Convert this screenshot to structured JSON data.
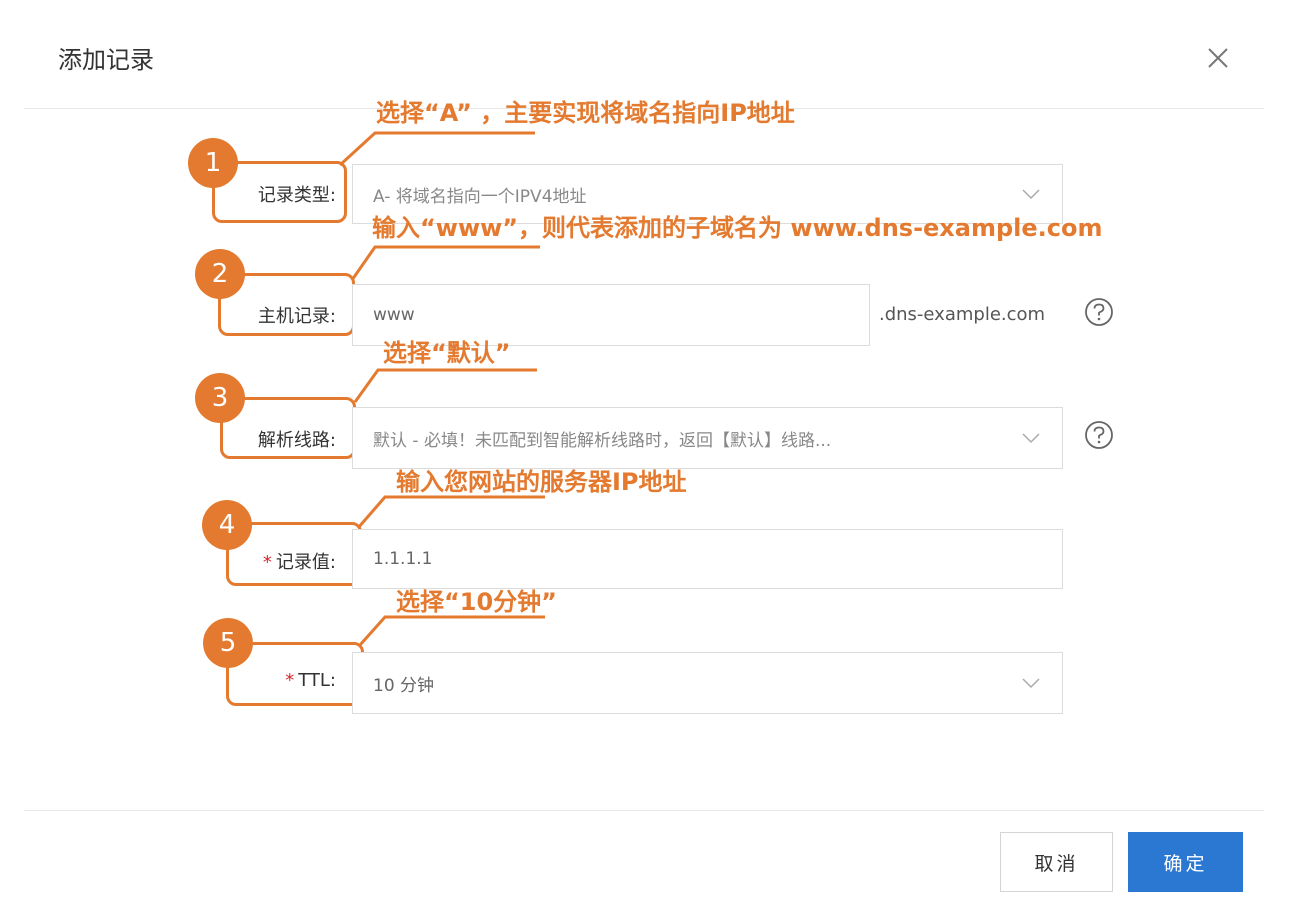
{
  "dialog": {
    "title": "添加记录",
    "close_icon": "close-icon"
  },
  "form": {
    "record_type": {
      "label": "记录类型:",
      "value": "A- 将域名指向一个IPV4地址"
    },
    "host_record": {
      "label": "主机记录:",
      "value": "www",
      "suffix": ".dns-example.com"
    },
    "resolve_line": {
      "label": "解析线路:",
      "value": "默认 - 必填！未匹配到智能解析线路时，返回【默认】线路..."
    },
    "record_value": {
      "required_mark": "*",
      "label": "记录值:",
      "value": "1.1.1.1"
    },
    "ttl": {
      "required_mark": "*",
      "label": "TTL:",
      "value": "10 分钟"
    }
  },
  "annotations": [
    {
      "number": "1",
      "text": "选择“A”  ，主要实现将域名指向IP地址"
    },
    {
      "number": "2",
      "text": "输入“www”，则代表添加的子域名为 www.dns-example.com"
    },
    {
      "number": "3",
      "text": "选择“默认”"
    },
    {
      "number": "4",
      "text": "输入您网站的服务器IP地址"
    },
    {
      "number": "5",
      "text": "选择“10分钟”"
    }
  ],
  "footer": {
    "cancel_label": "取消",
    "confirm_label": "确定"
  },
  "colors": {
    "annotation": "#e47a2f",
    "primary": "#2a78d1",
    "required": "#d9252b"
  }
}
